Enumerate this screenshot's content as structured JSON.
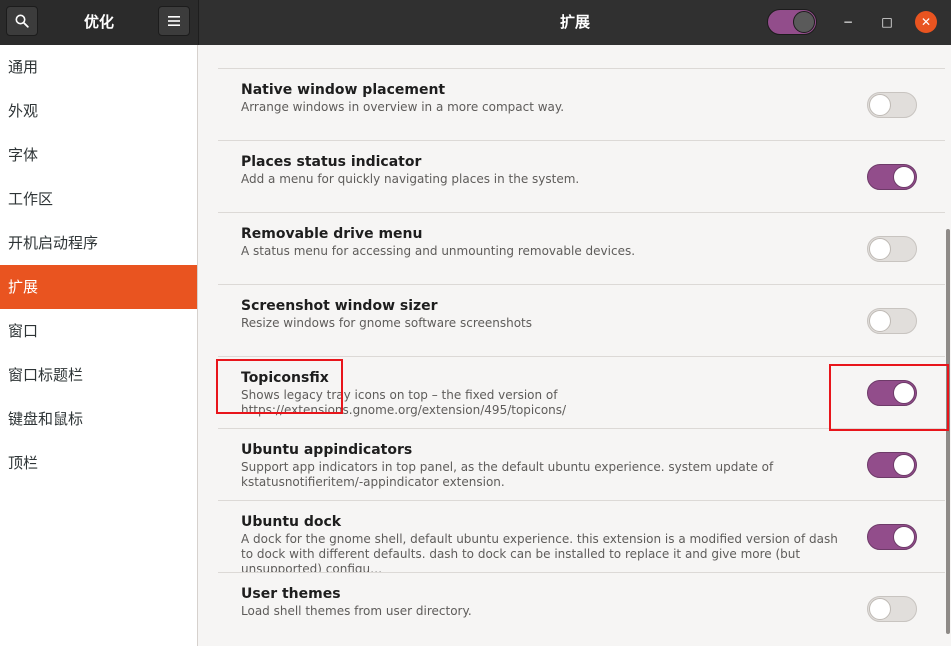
{
  "header": {
    "left_title": "优化",
    "right_title": "扩展",
    "search_icon": "search-icon",
    "menu_icon": "hamburger-menu-icon",
    "global_switch_on": true,
    "minimize_glyph": "−",
    "maximize_glyph": "□",
    "close_glyph": "✕",
    "accent_color": "#e95420",
    "switch_color": "#924d8b"
  },
  "sidebar": {
    "items": [
      {
        "label": "通用",
        "active": false
      },
      {
        "label": "外观",
        "active": false
      },
      {
        "label": "字体",
        "active": false
      },
      {
        "label": "工作区",
        "active": false
      },
      {
        "label": "开机启动程序",
        "active": false
      },
      {
        "label": "扩展",
        "active": true
      },
      {
        "label": "窗口",
        "active": false
      },
      {
        "label": "窗口标题栏",
        "active": false
      },
      {
        "label": "键盘和鼠标",
        "active": false
      },
      {
        "label": "顶栏",
        "active": false
      }
    ]
  },
  "extensions": [
    {
      "title": "Native window placement",
      "description": "Arrange windows in overview in a more compact way.",
      "enabled": false
    },
    {
      "title": "Places status indicator",
      "description": "Add a menu for quickly navigating places in the system.",
      "enabled": true
    },
    {
      "title": "Removable drive menu",
      "description": "A status menu for accessing and unmounting removable devices.",
      "enabled": false
    },
    {
      "title": "Screenshot window sizer",
      "description": "Resize windows for gnome software screenshots",
      "enabled": false
    },
    {
      "title": "Topiconsfix",
      "description": "Shows legacy tray icons on top – the fixed version of https://extensions.gnome.org/extension/495/topicons/",
      "enabled": true
    },
    {
      "title": "Ubuntu appindicators",
      "description": "Support app indicators in top panel, as the default ubuntu experience. system update of kstatusnotifieritem/-appindicator extension.",
      "enabled": true
    },
    {
      "title": "Ubuntu dock",
      "description": "A dock for the gnome shell, default ubuntu experience. this extension is a modified version of dash to dock with different defaults. dash to dock can be installed to replace it and give more (but unsupported) configu…",
      "enabled": true
    },
    {
      "title": "User themes",
      "description": "Load shell themes from user directory.",
      "enabled": false
    }
  ]
}
